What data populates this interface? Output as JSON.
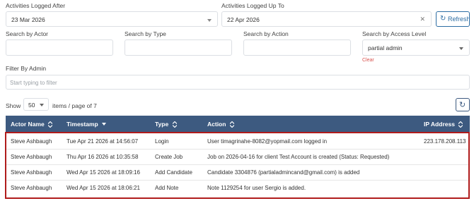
{
  "filters": {
    "after_label": "Activities Logged After",
    "after_value": "23 Mar 2026",
    "upto_label": "Activities Logged Up To",
    "upto_value": "22 Apr 2026",
    "refresh_label": "Refresh",
    "actor_label": "Search by Actor",
    "type_label": "Search by Type",
    "action_label": "Search by Action",
    "access_label": "Search by Access Level",
    "access_value": "partial admin",
    "clear_label": "Clear",
    "admin_label": "Filter By Admin",
    "admin_placeholder": "Start typing to filter"
  },
  "pager": {
    "show_label": "Show",
    "page_size": "50",
    "items_text": "items / page of 7"
  },
  "table": {
    "headers": {
      "actor": "Actor Name",
      "timestamp": "Timestamp",
      "type": "Type",
      "action": "Action",
      "ip": "IP Address"
    },
    "rows": [
      {
        "actor": "Steve Ashbaugh",
        "timestamp": "Tue Apr 21 2026 at 14:56:07",
        "type": "Login",
        "action": "User timagrinahe-8082@yopmail.com logged in",
        "ip": "223.178.208.113"
      },
      {
        "actor": "Steve Ashbaugh",
        "timestamp": "Thu Apr 16 2026 at 10:35:58",
        "type": "Create Job",
        "action": "Job on 2026-04-16 for client Test Account is created (Status: Requested)",
        "ip": ""
      },
      {
        "actor": "Steve Ashbaugh",
        "timestamp": "Wed Apr 15 2026 at 18:09:16",
        "type": "Add Candidate",
        "action": "Candidate 3304876 (partialadmincand@gmail.com) is added",
        "ip": ""
      },
      {
        "actor": "Steve Ashbaugh",
        "timestamp": "Wed Apr 15 2026 at 18:06:21",
        "type": "Add Note",
        "action": "Note 1129254 for user Sergio  is added.",
        "ip": ""
      }
    ]
  },
  "colors": {
    "header_bg": "#3d5a80",
    "highlight_border": "#b01c1c",
    "clear_red": "#d9534f",
    "refresh_blue": "#2d6da3"
  }
}
